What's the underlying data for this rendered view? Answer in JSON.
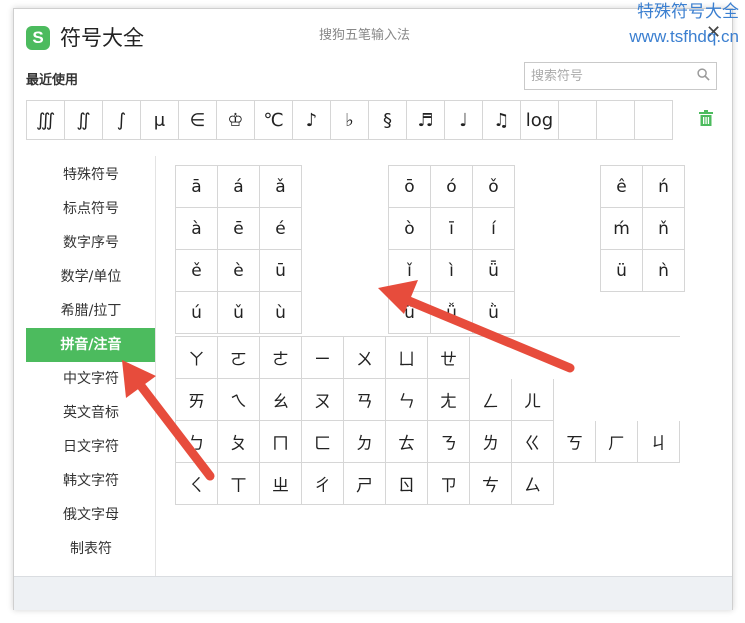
{
  "header": {
    "logo_letter": "S",
    "title": "符号大全",
    "ime_name": "搜狗五笔输入法",
    "close_glyph": "✕"
  },
  "watermark": {
    "line1": "特殊符号大全",
    "line2": "www.tsfhdq.cn"
  },
  "recent": {
    "label": "最近使用",
    "items": [
      "∭",
      "∬",
      "∫",
      "μ",
      "∈",
      "♔",
      "℃",
      "♪",
      "♭",
      "§",
      "♬",
      "♩",
      "♫",
      "log",
      "",
      "",
      ""
    ]
  },
  "search": {
    "placeholder": "搜索符号",
    "value": ""
  },
  "sidebar": {
    "items": [
      {
        "label": "特殊符号"
      },
      {
        "label": "标点符号"
      },
      {
        "label": "数字序号"
      },
      {
        "label": "数学/单位"
      },
      {
        "label": "希腊/拉丁"
      },
      {
        "label": "拼音/注音",
        "active": true
      },
      {
        "label": "中文字符"
      },
      {
        "label": "英文音标"
      },
      {
        "label": "日文字符"
      },
      {
        "label": "韩文字符"
      },
      {
        "label": "俄文字母"
      },
      {
        "label": "制表符"
      }
    ]
  },
  "pinyin": {
    "group1": [
      "ā",
      "á",
      "ǎ",
      "à",
      "ē",
      "é",
      "ě",
      "è",
      "ū",
      "ú",
      "ǔ",
      "ù"
    ],
    "group2": [
      "ō",
      "ó",
      "ǒ",
      "ò",
      "ī",
      "í",
      "ǐ",
      "ì",
      "ǖ",
      "ǘ",
      "ǚ",
      "ǜ"
    ],
    "group3": [
      "ê",
      "ń",
      "ḿ",
      "ň",
      "ü",
      "ǹ"
    ]
  },
  "zhuyin": {
    "rows": [
      [
        "ㄚ",
        "ㄛ",
        "ㄜ",
        "ㄧ",
        "ㄨ",
        "ㄩ",
        "ㄝ"
      ],
      [
        "ㄞ",
        "ㄟ",
        "ㄠ",
        "ㄡ",
        "ㄢ",
        "ㄣ",
        "ㄤ",
        "ㄥ",
        "ㄦ"
      ],
      [
        "ㄅ",
        "ㄆ",
        "ㄇ",
        "ㄈ",
        "ㄉ",
        "ㄊ",
        "ㄋ",
        "ㄌ",
        "ㄍ",
        "ㄎ",
        "ㄏ",
        "ㄐ"
      ],
      [
        "ㄑ",
        "ㄒ",
        "ㄓ",
        "ㄔ",
        "ㄕ",
        "ㄖ",
        "ㄗ",
        "ㄘ",
        "ㄙ"
      ]
    ]
  },
  "colors": {
    "accent": "#4cbb5e",
    "arrow": "#e74c3c",
    "watermark": "#3b7fd0"
  }
}
